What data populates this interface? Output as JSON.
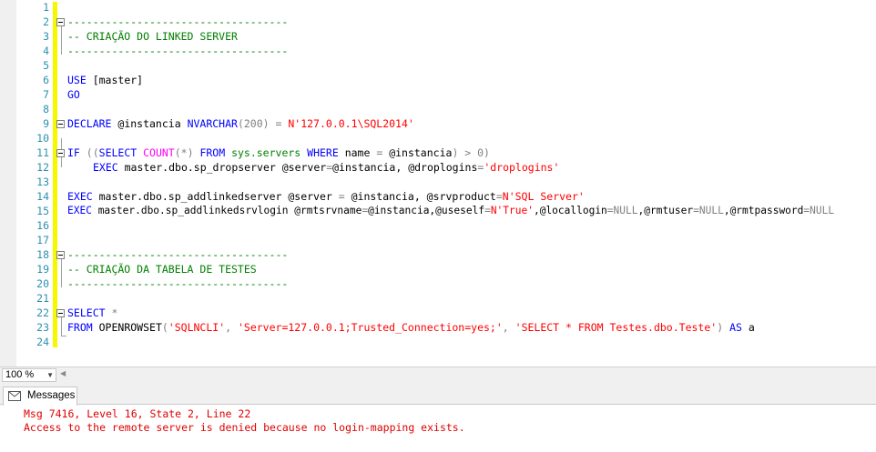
{
  "editor": {
    "line_numbers": [
      "1",
      "2",
      "3",
      "4",
      "5",
      "6",
      "7",
      "8",
      "9",
      "10",
      "11",
      "12",
      "13",
      "14",
      "15",
      "16",
      "17",
      "18",
      "19",
      "20",
      "21",
      "22",
      "23",
      "24"
    ],
    "lines": {
      "l2": "-----------------------------------",
      "l3": "-- CRIAÇÃO DO LINKED SERVER",
      "l4": "-----------------------------------",
      "l6_kw": "USE",
      "l6_rest": " [master]",
      "l7": "GO",
      "l9_kw": "DECLARE",
      "l9_var": " @instancia ",
      "l9_type": "NVARCHAR",
      "l9_paren": "(200) ",
      "l9_eq": "=",
      "l9_str": " N'127.0.0.1\\SQL2014'",
      "l11_if": "IF",
      "l11_p1": " ((",
      "l11_select": "SELECT",
      "l11_count": " COUNT",
      "l11_star": "(*) ",
      "l11_from": "FROM",
      "l11_sys": " sys.servers",
      "l11_where": " WHERE",
      "l11_name": " name ",
      "l11_eq": "=",
      "l11_var": " @instancia",
      "l11_close": ") > 0)",
      "l12_exec": "EXEC",
      "l12_proc": " master.dbo.sp_dropserver",
      "l12_args": " @server",
      "l12_eq": "=",
      "l12_a2": "@instancia, @droplogins",
      "l12_eq2": "=",
      "l12_str": "'droplogins'",
      "l14_exec": "EXEC",
      "l14_proc": " master.dbo.sp_addlinkedserver",
      "l14_a1": " @server ",
      "l14_eq": "=",
      "l14_a2": " @instancia, @srvproduct",
      "l14_eq2": "=",
      "l14_str": "N'SQL Server'",
      "l15_exec": "EXEC",
      "l15_proc": " master.dbo.sp_addlinkedsrvlogin",
      "l15_a1": " @rmtsrvname",
      "l15_eq1": "=",
      "l15_a2": "@instancia,@useself",
      "l15_eq2": "=",
      "l15_s1": "N'True'",
      "l15_a3": ",@locallogin",
      "l15_eq3": "=",
      "l15_n1": "NULL",
      "l15_a4": ",@rmtuser",
      "l15_eq4": "=",
      "l15_n2": "NULL",
      "l15_a5": ",@rmtpassword",
      "l15_eq5": "=",
      "l15_n3": "NULL",
      "l18": "-----------------------------------",
      "l19": "-- CRIAÇÃO DA TABELA DE TESTES",
      "l20": "-----------------------------------",
      "l22_select": "SELECT",
      "l22_star": " *",
      "l23_from": "FROM",
      "l23_fn": " OPENROWSET",
      "l23_p": "(",
      "l23_s1": "'SQLNCLI'",
      "l23_c1": ", ",
      "l23_s2": "'Server=127.0.0.1;Trusted_Connection=yes;'",
      "l23_c2": ", ",
      "l23_s3": "'SELECT * FROM Testes.dbo.Teste'",
      "l23_close": ") ",
      "l23_as": "AS",
      "l23_alias": " a"
    }
  },
  "statusbar": {
    "zoom": "100 %"
  },
  "results": {
    "tab_label": "Messages",
    "messages": [
      "Msg 7416, Level 16, State 2, Line 22",
      "Access to the remote server is denied because no login-mapping exists."
    ]
  },
  "colors": {
    "keyword": "#0000ff",
    "string": "#ff0000",
    "comment": "#008000",
    "error": "#e00000",
    "line_number": "#2b91af",
    "change_bar": "#f7f700"
  }
}
